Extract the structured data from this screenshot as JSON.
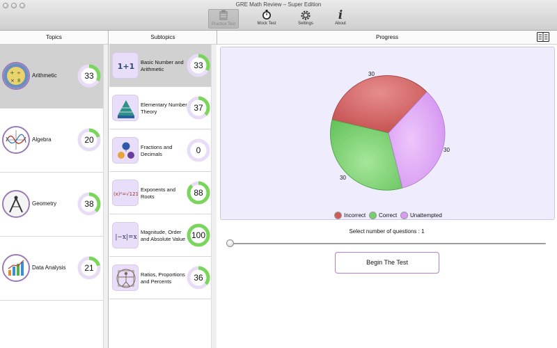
{
  "window": {
    "title": "GRE Math Review – Super Edition"
  },
  "toolbar": {
    "practice_test": "Practice Test",
    "mock_test": "Mock Test",
    "settings": "Settings",
    "about": "About"
  },
  "headers": {
    "topics": "Topics",
    "subtopics": "Subtopics",
    "progress": "Progress"
  },
  "topics": [
    {
      "label": "Arithmetic",
      "value": "33",
      "selected": true
    },
    {
      "label": "Algebra",
      "value": "20"
    },
    {
      "label": "Geometry",
      "value": "38"
    },
    {
      "label": "Data Analysis",
      "value": "21"
    }
  ],
  "subtopics": [
    {
      "label": "Basic Number and Arithmetic",
      "value": "33",
      "selected": true
    },
    {
      "label": "Elementary Number Theory",
      "value": "37"
    },
    {
      "label": "Fractions and Decimals",
      "value": "0"
    },
    {
      "label": "Exponents and Roots",
      "value": "88"
    },
    {
      "label": "Magnitude, Order and Absolute Value",
      "value": "100"
    },
    {
      "label": "Ratios, Proportions and Percents",
      "value": "36"
    }
  ],
  "progress": {
    "pie_labels": [
      "30",
      "30",
      "30"
    ],
    "legend": {
      "incorrect": "Incorrect",
      "correct": "Correct",
      "unattempted": "Unattempted"
    },
    "select_text": "Select number of questions : 1",
    "begin_button": "Begin The Test"
  },
  "colors": {
    "incorrect": "#cf5a5a",
    "correct": "#74cf6c",
    "unattempted": "#d79bf2",
    "ring_fill": "#79d65b",
    "ring_track": "#e9dcf6"
  }
}
